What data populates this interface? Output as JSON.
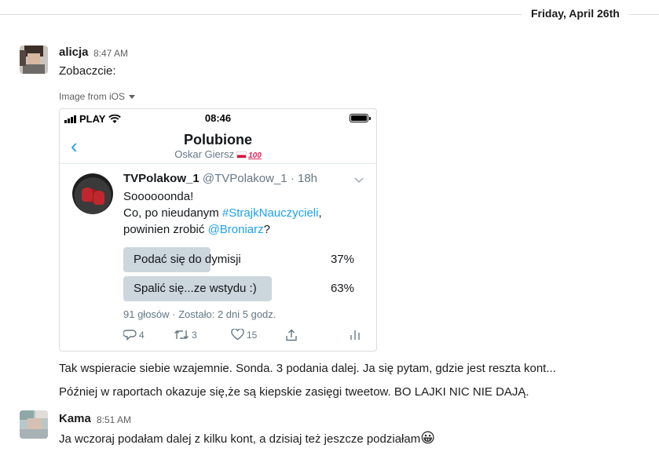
{
  "date_divider": "Friday, April 26th",
  "messages": [
    {
      "sender": "alicja",
      "time": "8:47 AM",
      "text": "Zobaczcie:",
      "attachment_label": "Image from iOS",
      "followups": [
        "Tak wspieracie siebie wzajemnie. Sonda. 3 podania dalej. Ja się pytam, gdzie jest reszta kont...",
        "Później w raportach okazuje się,że są kiepskie zasięgi tweetow. BO LAJKI NIC NIE DAJĄ."
      ]
    },
    {
      "sender": "Kama",
      "time": "8:51 AM",
      "text": "Ja wczoraj podałam dalej z kilku kont, a dzisiaj też jeszcze podziałam",
      "emoji": "😀"
    }
  ],
  "screenshot": {
    "status_bar": {
      "carrier": "PLAY",
      "time": "08:46"
    },
    "nav": {
      "back": "‹",
      "title": "Polubione",
      "subtitle": "Oskar Giersz",
      "hundred": "100"
    },
    "tweet": {
      "name": "TVPolakow_1",
      "handle_meta": "@TVPolakow_1 · 18h",
      "line1": "Soooooonda!",
      "line2_pre": "Co, po nieudanym ",
      "line2_link": "#StrajkNauczycieli",
      "line2_post": ",",
      "line3_pre": "powinien zrobić ",
      "line3_link": "@Broniarz",
      "line3_post": "?",
      "poll": [
        {
          "label": "Podać się do dymisji",
          "percent_text": "37%",
          "value": 37
        },
        {
          "label": "Spalić się...ze wstydu :)",
          "percent_text": "63%",
          "value": 63
        }
      ],
      "poll_footer": "91 głosów · Zostało: 2 dni 5 godz.",
      "actions": {
        "replies": "4",
        "retweets": "3",
        "likes": "15"
      }
    }
  },
  "colors": {
    "link": "#1da1f2",
    "poll_fill": "#ccd6dd",
    "text": "#1d1c1d",
    "muted": "#616061"
  }
}
